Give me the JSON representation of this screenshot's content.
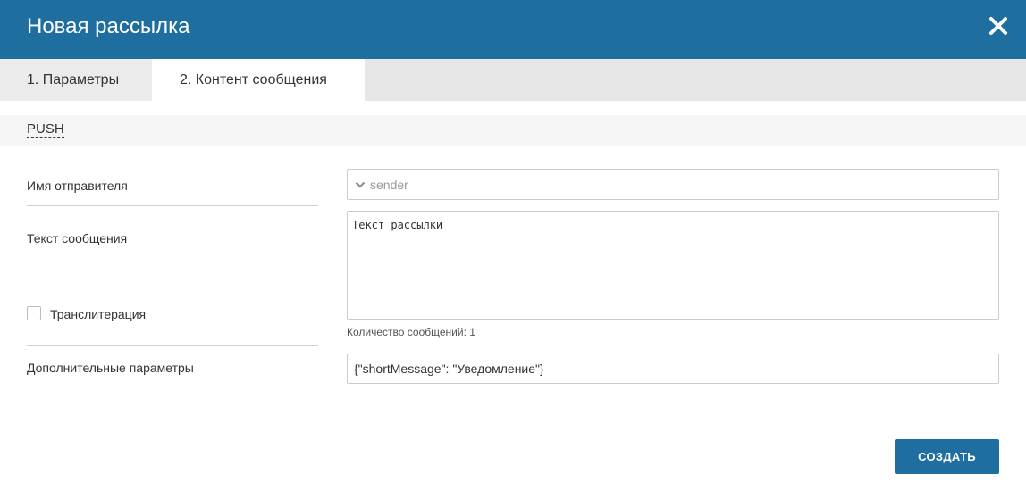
{
  "dialog": {
    "title": "Новая рассылка"
  },
  "tabs": [
    {
      "label": "1. Параметры",
      "active": false
    },
    {
      "label": "2. Контент сообщения",
      "active": true
    }
  ],
  "channel": {
    "label": "PUSH"
  },
  "form": {
    "sender": {
      "label": "Имя отправителя",
      "placeholder": "sender"
    },
    "message": {
      "label": "Текст сообщения",
      "value": "Текст рассылки",
      "count_text": "Количество сообщений: 1"
    },
    "transliteration": {
      "label": "Транслитерация",
      "checked": false
    },
    "extra_params": {
      "label": "Дополнительные параметры",
      "value": "{\"shortMessage\": \"Уведомление\"}"
    }
  },
  "actions": {
    "create_label": "СОЗДАТЬ"
  },
  "colors": {
    "header": "#1e6f9f",
    "primary_button": "#1e6f9f",
    "tab_bar": "#e6e6e6"
  },
  "icons": {
    "close": "close-icon",
    "dropdown": "chevron-down-icon"
  }
}
